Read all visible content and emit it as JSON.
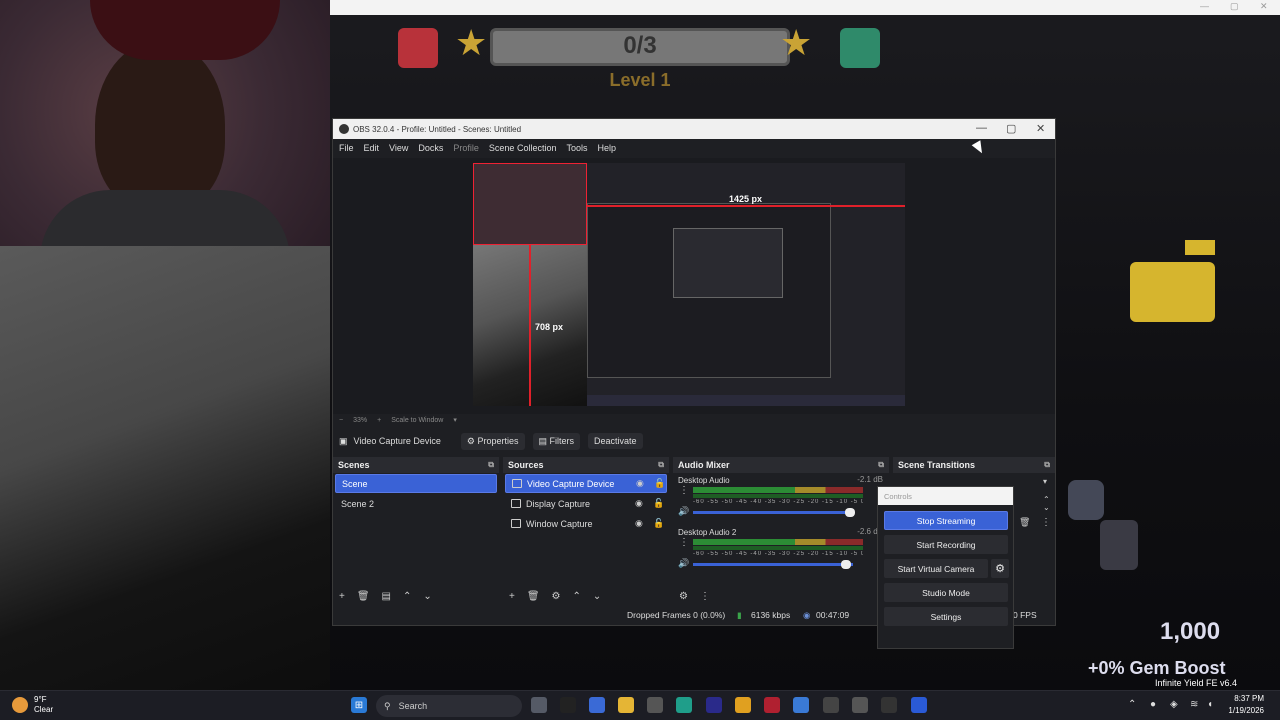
{
  "game": {
    "progress": "0/3",
    "level": "Level 1",
    "gems": "1,000",
    "gem_boost": "+0% Gem Boost",
    "infinite_yield": "Infinite Yield FE v6.4",
    "window_controls": [
      "—",
      "▢",
      "✕"
    ]
  },
  "obs": {
    "title": "OBS 32.0.4 - Profile: Untitled - Scenes: Untitled",
    "menu": [
      "File",
      "Edit",
      "View",
      "Docks",
      "Profile",
      "Scene Collection",
      "Tools",
      "Help"
    ],
    "window_controls": [
      "—",
      "▢",
      "✕"
    ],
    "preview": {
      "width_label": "1425 px",
      "height_label": "708 px"
    },
    "zoom_bar": {
      "minus": "−",
      "zoom": "33%",
      "plus": "+",
      "scale_mode": "Scale to Window",
      "dropdown": "▾"
    },
    "source_bar": {
      "selected_source": "Video Capture Device",
      "properties_label": "Properties",
      "filters_label": "Filters",
      "deactivate_label": "Deactivate"
    },
    "scenes": {
      "title": "Scenes",
      "items": [
        "Scene",
        "Scene 2"
      ]
    },
    "sources": {
      "title": "Sources",
      "items": [
        "Video Capture Device",
        "Display Capture",
        "Window Capture"
      ]
    },
    "audio_mixer": {
      "title": "Audio Mixer",
      "channels": [
        {
          "name": "Desktop Audio",
          "db": "-2.1 dB",
          "level": 0.88
        },
        {
          "name": "Desktop Audio 2",
          "db": "-2.6 dB",
          "level": 0.86
        }
      ],
      "scale": "-60 -55 -50 -45 -40 -35 -30 -25 -20 -15 -10 -5 0"
    },
    "scene_transitions": {
      "title": "Scene Transitions"
    },
    "status": {
      "dropped_frames": "Dropped Frames 0 (0.0%)",
      "bitrate": "6136 kbps",
      "time": "00:47:09",
      "fps": "0 FPS"
    },
    "controls": {
      "title": "Controls",
      "buttons": [
        "Stop Streaming",
        "Start Recording",
        "Start Virtual Camera",
        "Studio Mode",
        "Settings"
      ]
    }
  },
  "taskbar": {
    "weather_temp": "9°F",
    "weather_desc": "Clear",
    "search_placeholder": "Search",
    "time": "8:37 PM",
    "date": "1/19/2026"
  }
}
